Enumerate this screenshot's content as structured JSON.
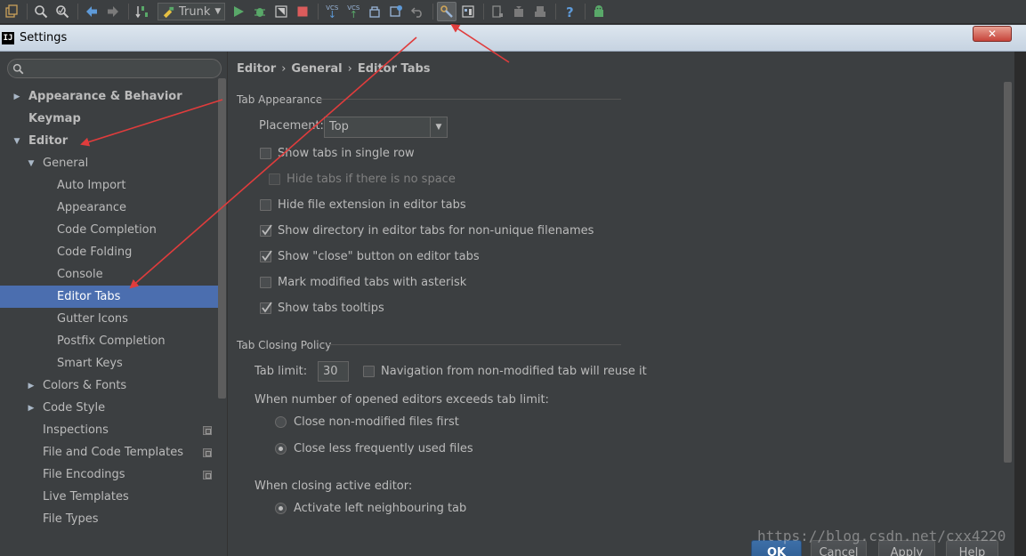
{
  "toolbar": {
    "branch_label": "Trunk",
    "vcs_label": "VCS",
    "accent_run": "#59a869",
    "accent_stop": "#db5c5c"
  },
  "window": {
    "logo_text": "IJ",
    "title": "Settings",
    "close_glyph": "✕"
  },
  "sidebar": {
    "search_placeholder": "",
    "items": [
      {
        "label": "Appearance & Behavior",
        "level": 0,
        "expand": "collapsed",
        "bold": true
      },
      {
        "label": "Keymap",
        "level": 0,
        "expand": "none",
        "bold": true
      },
      {
        "label": "Editor",
        "level": 0,
        "expand": "expanded",
        "bold": true
      },
      {
        "label": "General",
        "level": 1,
        "expand": "expanded"
      },
      {
        "label": "Auto Import",
        "level": 2,
        "expand": "none"
      },
      {
        "label": "Appearance",
        "level": 2,
        "expand": "none"
      },
      {
        "label": "Code Completion",
        "level": 2,
        "expand": "none"
      },
      {
        "label": "Code Folding",
        "level": 2,
        "expand": "none"
      },
      {
        "label": "Console",
        "level": 2,
        "expand": "none"
      },
      {
        "label": "Editor Tabs",
        "level": 2,
        "expand": "none",
        "selected": true
      },
      {
        "label": "Gutter Icons",
        "level": 2,
        "expand": "none"
      },
      {
        "label": "Postfix Completion",
        "level": 2,
        "expand": "none"
      },
      {
        "label": "Smart Keys",
        "level": 2,
        "expand": "none"
      },
      {
        "label": "Colors & Fonts",
        "level": 1,
        "expand": "collapsed"
      },
      {
        "label": "Code Style",
        "level": 1,
        "expand": "collapsed"
      },
      {
        "label": "Inspections",
        "level": 1,
        "expand": "none",
        "project_icon": true
      },
      {
        "label": "File and Code Templates",
        "level": 1,
        "expand": "none",
        "project_icon": true
      },
      {
        "label": "File Encodings",
        "level": 1,
        "expand": "none",
        "project_icon": true
      },
      {
        "label": "Live Templates",
        "level": 1,
        "expand": "none"
      },
      {
        "label": "File Types",
        "level": 1,
        "expand": "none"
      }
    ]
  },
  "content": {
    "breadcrumb": [
      "Editor",
      "General",
      "Editor Tabs"
    ],
    "breadcrumb_sep": "›",
    "tab_appearance": {
      "title": "Tab Appearance",
      "placement_label": "Placement:",
      "placement_value": "Top",
      "options": [
        {
          "label": "Show tabs in single row",
          "checked": false
        },
        {
          "label": "Hide tabs if there is no space",
          "checked": false,
          "disabled": true
        },
        {
          "label": "Hide file extension in editor tabs",
          "checked": false
        },
        {
          "label": "Show directory in editor tabs for non-unique filenames",
          "checked": true
        },
        {
          "label": "Show \"close\" button on editor tabs",
          "checked": true
        },
        {
          "label": "Mark modified tabs with asterisk",
          "checked": false
        },
        {
          "label": "Show tabs tooltips",
          "checked": true
        }
      ]
    },
    "tab_closing": {
      "title": "Tab Closing Policy",
      "limit_label": "Tab limit:",
      "limit_value": "30",
      "reuse_label": "Navigation from non-modified tab will reuse it",
      "reuse_checked": false,
      "exceeds_label": "When number of opened editors exceeds tab limit:",
      "exceeds_options": [
        {
          "label": "Close non-modified files first",
          "selected": false
        },
        {
          "label": "Close less frequently used files",
          "selected": true
        }
      ],
      "closing_label": "When closing active editor:",
      "closing_options": [
        {
          "label": "Activate left neighbouring tab",
          "selected": true
        }
      ]
    }
  },
  "buttons": {
    "ok": "OK",
    "cancel": "Cancel",
    "apply": "Apply",
    "help": "Help"
  },
  "watermark": "https://blog.csdn.net/cxx4220",
  "colors": {
    "background": "#3c3f41",
    "selection": "#4b6eaf",
    "annotation_arrow": "#e03c3c",
    "text": "#bbbbbb"
  }
}
